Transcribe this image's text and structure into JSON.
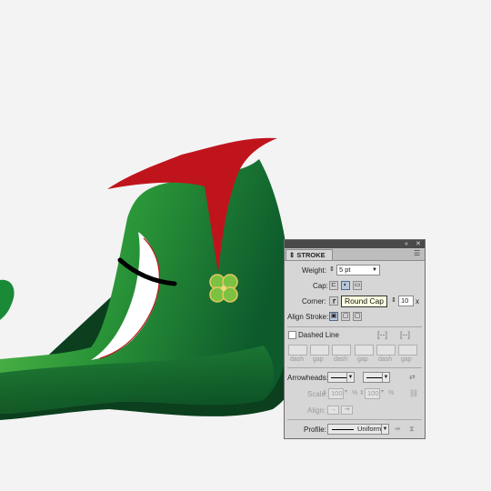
{
  "panel": {
    "title": "STROKE",
    "collapse_icon": "double-chevron-left-icon",
    "close_icon": "close-icon",
    "menu_icon": "panel-menu-icon",
    "weight_label": "Weight:",
    "weight_value": "5 pt",
    "cap_label": "Cap:",
    "cap_selected": "round",
    "corner_label": "Corner:",
    "limit_suffix": "t:",
    "limit_value": "10",
    "limit_unit": "x",
    "align_label": "Align Stroke:",
    "dashed_line_label": "Dashed Line",
    "dashed_line_checked": false,
    "dash_labels": [
      "dash",
      "gap",
      "dash",
      "gap",
      "dash",
      "gap"
    ],
    "arrowheads_label": "Arrowheads:",
    "scale_label": "Scale:",
    "scale_start": "100",
    "scale_end": "100",
    "percent": "%",
    "align_arrow_label": "Align:",
    "profile_label": "Profile:",
    "profile_value": "Uniform"
  },
  "tooltip": "Round Cap",
  "colors": {
    "shoe_green_light": "#52b848",
    "shoe_green_dark": "#0f5a2a",
    "cuff_red": "#c0141c",
    "clover_green": "#7cc242",
    "clover_gold": "#e8c760",
    "stroke_black": "#000000",
    "panel_bg": "#d6d6d6",
    "tooltip_bg": "#ffffe1"
  }
}
